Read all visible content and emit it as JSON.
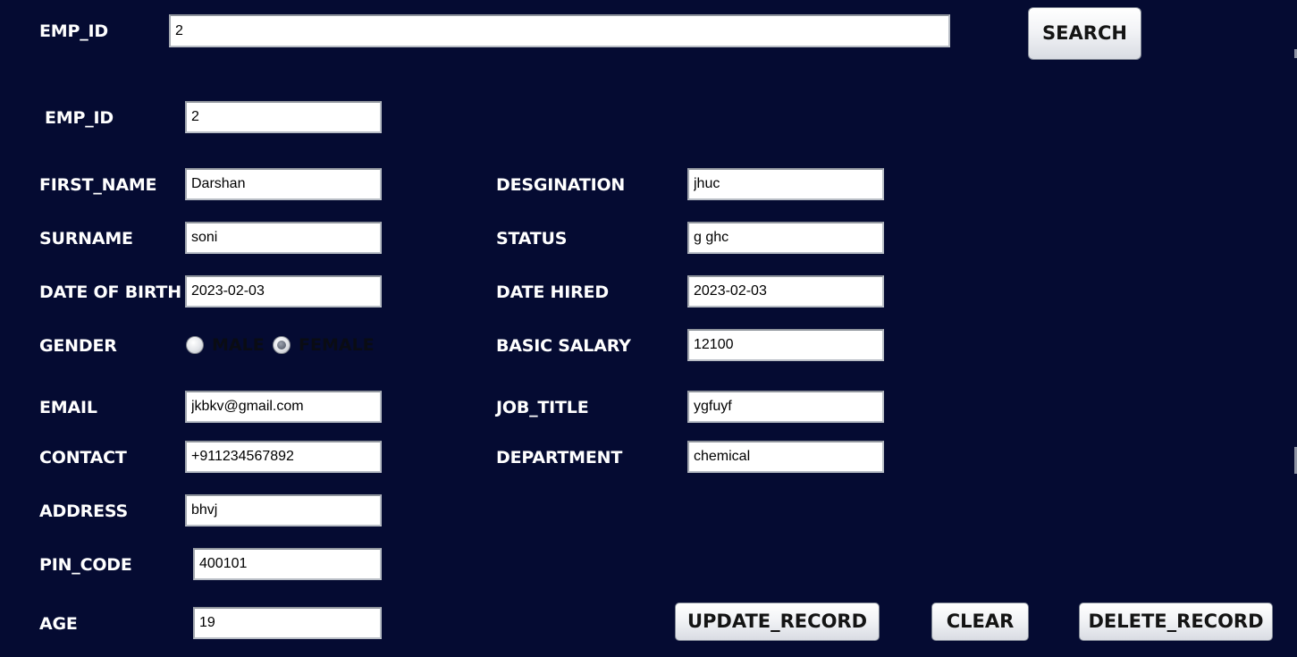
{
  "search": {
    "label": "EMP_ID",
    "value": "2",
    "button_label": "SEARCH"
  },
  "form": {
    "emp_id": {
      "label": "EMP_ID",
      "value": "2"
    },
    "first_name": {
      "label": "FIRST_NAME",
      "value": "Darshan"
    },
    "surname": {
      "label": "SURNAME",
      "value": "soni"
    },
    "dob": {
      "label": "DATE OF BIRTH",
      "value": "2023-02-03"
    },
    "gender": {
      "label": "GENDER",
      "options": [
        "MALE",
        "FEMALE"
      ],
      "selected": "FEMALE"
    },
    "email": {
      "label": "EMAIL",
      "value": "jkbkv@gmail.com"
    },
    "contact": {
      "label": "CONTACT",
      "value": "+911234567892"
    },
    "address": {
      "label": "ADDRESS",
      "value": "bhvj"
    },
    "pin_code": {
      "label": "PIN_CODE",
      "value": "400101"
    },
    "age": {
      "label": "AGE",
      "value": "19"
    },
    "designation": {
      "label": "DESGINATION",
      "value": "jhuc"
    },
    "status": {
      "label": "STATUS",
      "value": "g ghc"
    },
    "date_hired": {
      "label": "DATE HIRED",
      "value": "2023-02-03"
    },
    "basic_salary": {
      "label": "BASIC SALARY",
      "value": "12100"
    },
    "job_title": {
      "label": "JOB_TITLE",
      "value": "ygfuyf"
    },
    "department": {
      "label": "DEPARTMENT",
      "value": "chemical"
    }
  },
  "actions": {
    "update_label": "UPDATE_RECORD",
    "clear_label": "CLEAR",
    "delete_label": "DELETE_RECORD"
  },
  "colors": {
    "background": "#050b32",
    "label_text": "#ffffff",
    "field_background": "#ffffff"
  }
}
